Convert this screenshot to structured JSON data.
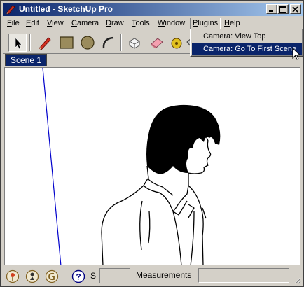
{
  "window": {
    "title": "Untitled - SketchUp Pro",
    "controls": [
      "minimize-icon",
      "maximize-icon",
      "close-icon"
    ]
  },
  "menubar": {
    "items": [
      {
        "label": "File",
        "underline": "F"
      },
      {
        "label": "Edit",
        "underline": "E"
      },
      {
        "label": "View",
        "underline": "V"
      },
      {
        "label": "Camera",
        "underline": "C"
      },
      {
        "label": "Draw",
        "underline": "D"
      },
      {
        "label": "Tools",
        "underline": "T"
      },
      {
        "label": "Window",
        "underline": "W"
      },
      {
        "label": "Plugins",
        "underline": "P",
        "open": true
      },
      {
        "label": "Help",
        "underline": "H"
      }
    ]
  },
  "plugins_menu": {
    "items": [
      {
        "label": "Camera: View Top",
        "highlighted": false
      },
      {
        "label": "Camera: Go To First Scene",
        "highlighted": true
      }
    ]
  },
  "toolbar": {
    "tools": [
      "select-arrow-icon",
      "pencil-icon",
      "rectangle-icon",
      "circle-icon",
      "arc-icon",
      "make-component-icon",
      "eraser-icon",
      "paint-bucket-icon",
      "tape-measure-icon"
    ]
  },
  "scenes": {
    "tabs": [
      {
        "label": "Scene 1",
        "active": true
      }
    ]
  },
  "statusbar": {
    "icons": [
      "geo-location-icon",
      "credits-icon",
      "sign-in-icon",
      "help-icon"
    ],
    "hint": "S",
    "measurements_label": "Measurements",
    "measurements_value": ""
  },
  "colors": {
    "titlebar": "#0a246a",
    "chrome": "#d4d0c8",
    "highlight": "#0a246a",
    "axis_blue": "#0000cc"
  }
}
